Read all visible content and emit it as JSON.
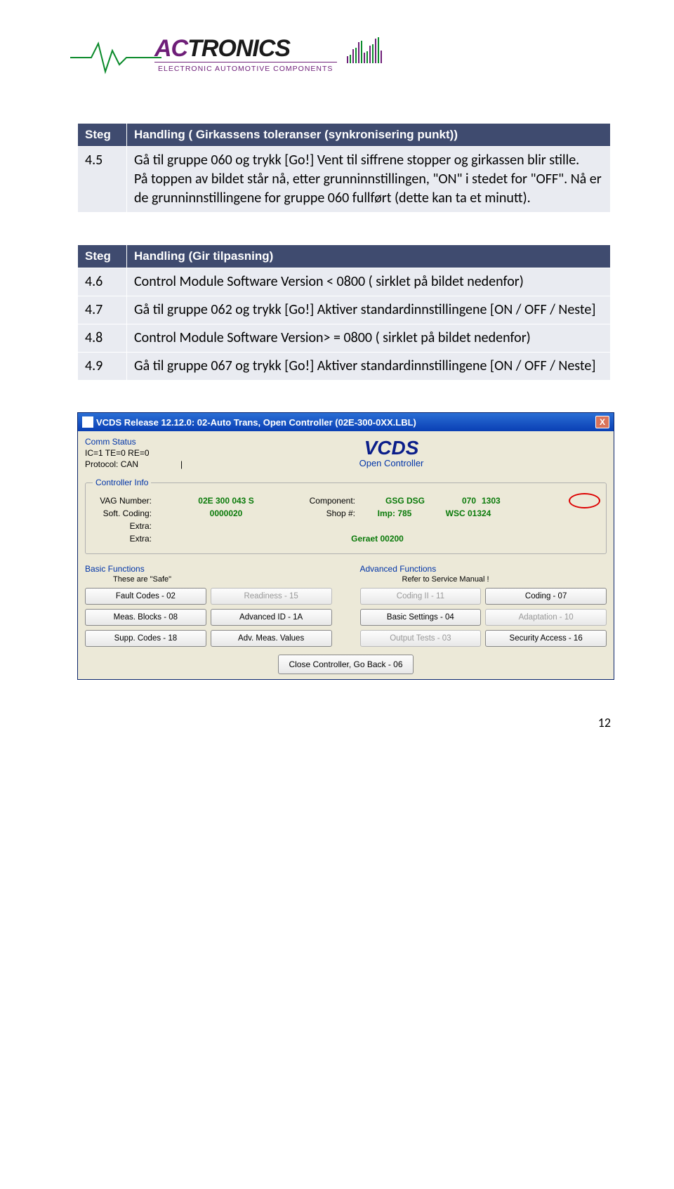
{
  "logo": {
    "brand_a": "AC",
    "brand_b": "TRONICS",
    "sub": "ELECTRONIC AUTOMOTIVE COMPONENTS"
  },
  "table1": {
    "head_steg": "Steg",
    "head_handling": "Handling ( Girkassens toleranser (synkronisering punkt))",
    "rows": [
      {
        "num": "4.5",
        "text": "Gå til gruppe 060 og trykk [Go!] Vent til siffrene stopper og girkassen blir stille.\nPå toppen av bildet står nå, etter grunninnstillingen, \"ON\" i stedet for \"OFF\". Nå er de grunninnstillingene for gruppe 060 fullført (dette kan ta et minutt)."
      }
    ]
  },
  "table2": {
    "head_steg": "Steg",
    "head_handling": "Handling (Gir tilpasning)",
    "rows": [
      {
        "num": "4.6",
        "text": "Control Module Software Version < 0800  ( sirklet på bildet nedenfor)"
      },
      {
        "num": "4.7",
        "text": "Gå til gruppe 062 og trykk [Go!] Aktiver standardinnstillingene [ON / OFF / Neste]"
      },
      {
        "num": "4.8",
        "text": "Control Module Software Version> = 0800  ( sirklet på bildet nedenfor)"
      },
      {
        "num": "4.9",
        "text": "Gå til gruppe 067 og trykk [Go!] Aktiver standardinnstillingene [ON / OFF / Neste]"
      }
    ]
  },
  "vcds": {
    "title": "VCDS Release 12.12.0: 02-Auto Trans,  Open Controller (02E-300-0XX.LBL)",
    "close_x": "X",
    "comm_status_label": "Comm Status",
    "comm_line1": "IC=1  TE=0  RE=0",
    "comm_line2": "Protocol: CAN",
    "logo": "VCDS",
    "logo_sub": "Open Controller",
    "ctrl_legend": "Controller Info",
    "labels": {
      "vag": "VAG Number:",
      "soft": "Soft. Coding:",
      "extra1": "Extra:",
      "extra2": "Extra:",
      "component": "Component:",
      "shop": "Shop #:"
    },
    "values": {
      "vag": "02E 300 043 S",
      "soft": "0000020",
      "component": "GSG DSG",
      "component_right": "070",
      "component_circled": "1303",
      "shop_imp": "Imp: 785",
      "shop_wsc": "WSC 01324",
      "extra2": "Geraet 00200"
    },
    "basic": {
      "title": "Basic Functions",
      "sub": "These are \"Safe\"",
      "btns": [
        {
          "t": "Fault Codes - 02",
          "d": false
        },
        {
          "t": "Readiness - 15",
          "d": true
        },
        {
          "t": "Meas. Blocks - 08",
          "d": false
        },
        {
          "t": "Advanced ID - 1A",
          "d": false
        },
        {
          "t": "Supp. Codes - 18",
          "d": false
        },
        {
          "t": "Adv. Meas. Values",
          "d": false
        }
      ]
    },
    "adv": {
      "title": "Advanced Functions",
      "sub": "Refer to Service Manual !",
      "btns": [
        {
          "t": "Coding II - 11",
          "d": true
        },
        {
          "t": "Coding - 07",
          "d": false
        },
        {
          "t": "Basic Settings - 04",
          "d": false
        },
        {
          "t": "Adaptation - 10",
          "d": true
        },
        {
          "t": "Output Tests - 03",
          "d": true
        },
        {
          "t": "Security Access - 16",
          "d": false
        }
      ]
    },
    "close_btn": "Close Controller, Go Back - 06"
  },
  "page_number": "12"
}
